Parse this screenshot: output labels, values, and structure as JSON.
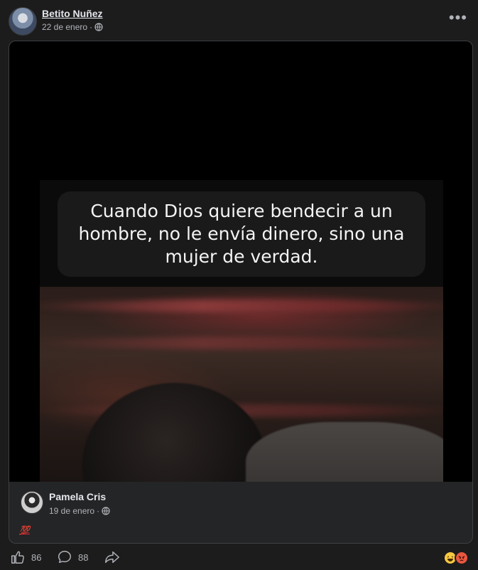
{
  "post": {
    "author": "Betito Nuñez",
    "date": "22 de enero",
    "separator": "·",
    "privacy_icon": "globe-icon",
    "menu_icon": "more-horizontal-icon"
  },
  "shared": {
    "caption": "Cuando Dios quiere bendecir a un\nhombre, no le envía dinero, sino una\nmujer de verdad.",
    "original_author": "Pamela Cris",
    "original_date": "19 de enero",
    "separator": "·",
    "text": "💯"
  },
  "actions": {
    "like_count": "86",
    "comment_count": "88",
    "like_icon": "thumbs-up-icon",
    "comment_icon": "comment-icon",
    "share_icon": "share-icon",
    "reaction_icons": [
      "laughing-face-icon",
      "angry-face-icon"
    ]
  },
  "colors": {
    "background": "#1c1c1d",
    "card": "#242526",
    "text_primary": "#e4e6eb",
    "text_secondary": "#b0b3b8"
  }
}
